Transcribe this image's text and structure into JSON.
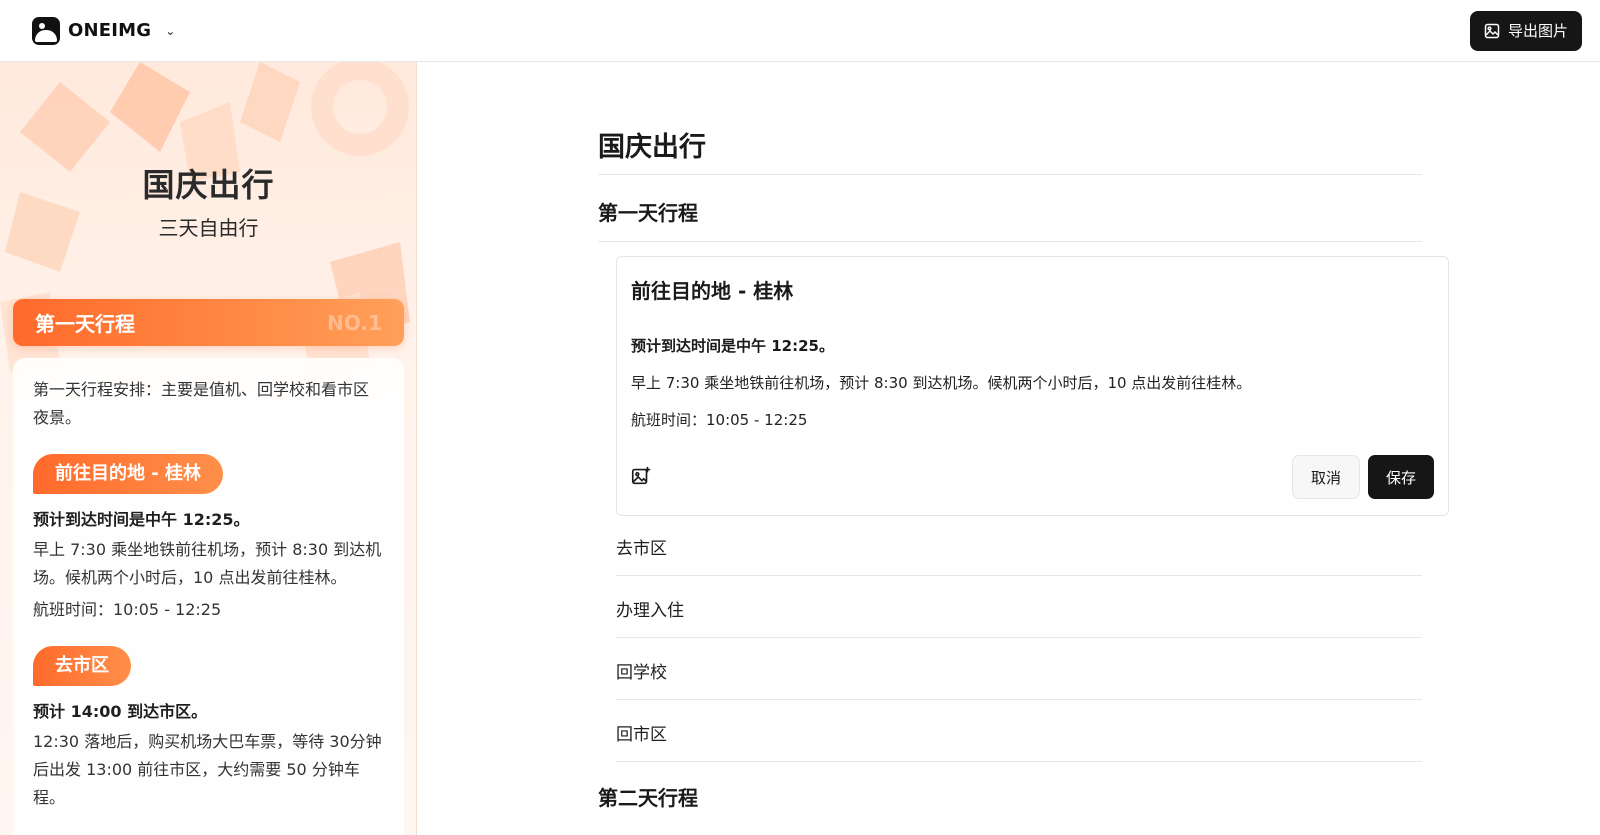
{
  "topbar": {
    "brand_name": "ONEIMG",
    "brand_chevron": "⌄",
    "export_label": "导出图片"
  },
  "preview": {
    "title": "国庆出行",
    "subtitle": "三天自由行",
    "day_banner": {
      "label": "第一天行程",
      "number": "NO.1"
    },
    "intro": "第一天行程安排：主要是值机、回学校和看市区夜景。",
    "sections": [
      {
        "pill": "前往目的地 - 桂林",
        "bold": "预计到达时间是中午 12:25。",
        "text": "早上 7:30 乘坐地铁前往机场，预计 8:30 到达机场。候机两个小时后，10 点出发前往桂林。",
        "text2": "航班时间：10:05 - 12:25"
      },
      {
        "pill": "去市区",
        "bold": "预计 14:00 到达市区。",
        "text": "12:30 落地后，购买机场大巴车票，等待 30分钟后出发 13:00 前往市区，大约需要 50 分钟车程。"
      }
    ]
  },
  "editor": {
    "title": "国庆出行",
    "day1_heading": "第一天行程",
    "card": {
      "title": "前往目的地 - 桂林",
      "bold": "预计到达时间是中午 12:25。",
      "line1": "早上 7:30 乘坐地铁前往机场，预计 8:30 到达机场。候机两个小时后，10 点出发前往桂林。",
      "line2": "航班时间：10:05 - 12:25",
      "cancel_label": "取消",
      "save_label": "保存"
    },
    "items": [
      "去市区",
      "办理入住",
      "回学校",
      "回市区"
    ],
    "day2_heading": "第二天行程"
  },
  "colors": {
    "accent": "#ff6a2b",
    "accent_light": "#ffa05a",
    "dark_button": "#161616"
  }
}
